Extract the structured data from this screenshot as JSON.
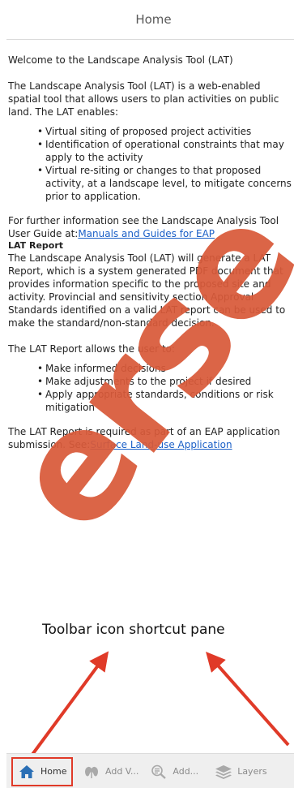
{
  "header": {
    "title": "Home"
  },
  "content": {
    "welcome": "Welcome to the Landscape Analysis Tool (LAT)",
    "intro": "The Landscape Analysis Tool (LAT) is a web-enabled spatial tool that allows users to plan activities on public land. The LAT enables:",
    "enables_list": [
      "Virtual siting of proposed project activities",
      "Identification of operational constraints that may apply to the activity",
      "Virtual re-siting or changes to that proposed activity, at a landscape level, to mitigate concerns prior to application."
    ],
    "further_info": "For further information see the Landscape Analysis Tool User Guide at:",
    "further_link": "Manuals and Guides for EAP",
    "lat_report_heading": "LAT Report",
    "lat_report_desc": "The Landscape Analysis Tool (LAT) will generate a LAT Report, which is a system generated PDF document that provides information specific to the proposed site and activity. Provincial and sensitivity section Approval Standards identified on a valid LAT report can be used to make the standard/non-standard decision.",
    "allows_intro": "The LAT Report allows the user to:",
    "allows_list": [
      "Make informed decisions",
      "Make adjustments to the project if desired",
      "Apply appropriate standards, conditions or risk mitigation"
    ],
    "required_text": "The LAT Report is required as part of an EAP application submission. See:",
    "required_link": "Surface Land-use Application"
  },
  "annotation": {
    "label": "Toolbar icon shortcut pane",
    "color": "#e03a28"
  },
  "watermark": {
    "text": "erse",
    "color": "#d95a3a"
  },
  "toolbar": {
    "items": [
      {
        "label": "Home",
        "icon": "home-icon",
        "active": true
      },
      {
        "label": "Add V...",
        "icon": "add-v-icon",
        "active": false
      },
      {
        "label": "Add...",
        "icon": "magnifier-add-icon",
        "active": false
      },
      {
        "label": "Layers",
        "icon": "layers-icon",
        "active": false
      }
    ]
  },
  "colors": {
    "link": "#1a5fc7",
    "home_icon": "#2a6fb5",
    "highlight": "#e03a28",
    "toolbar_bg": "#efefef"
  }
}
